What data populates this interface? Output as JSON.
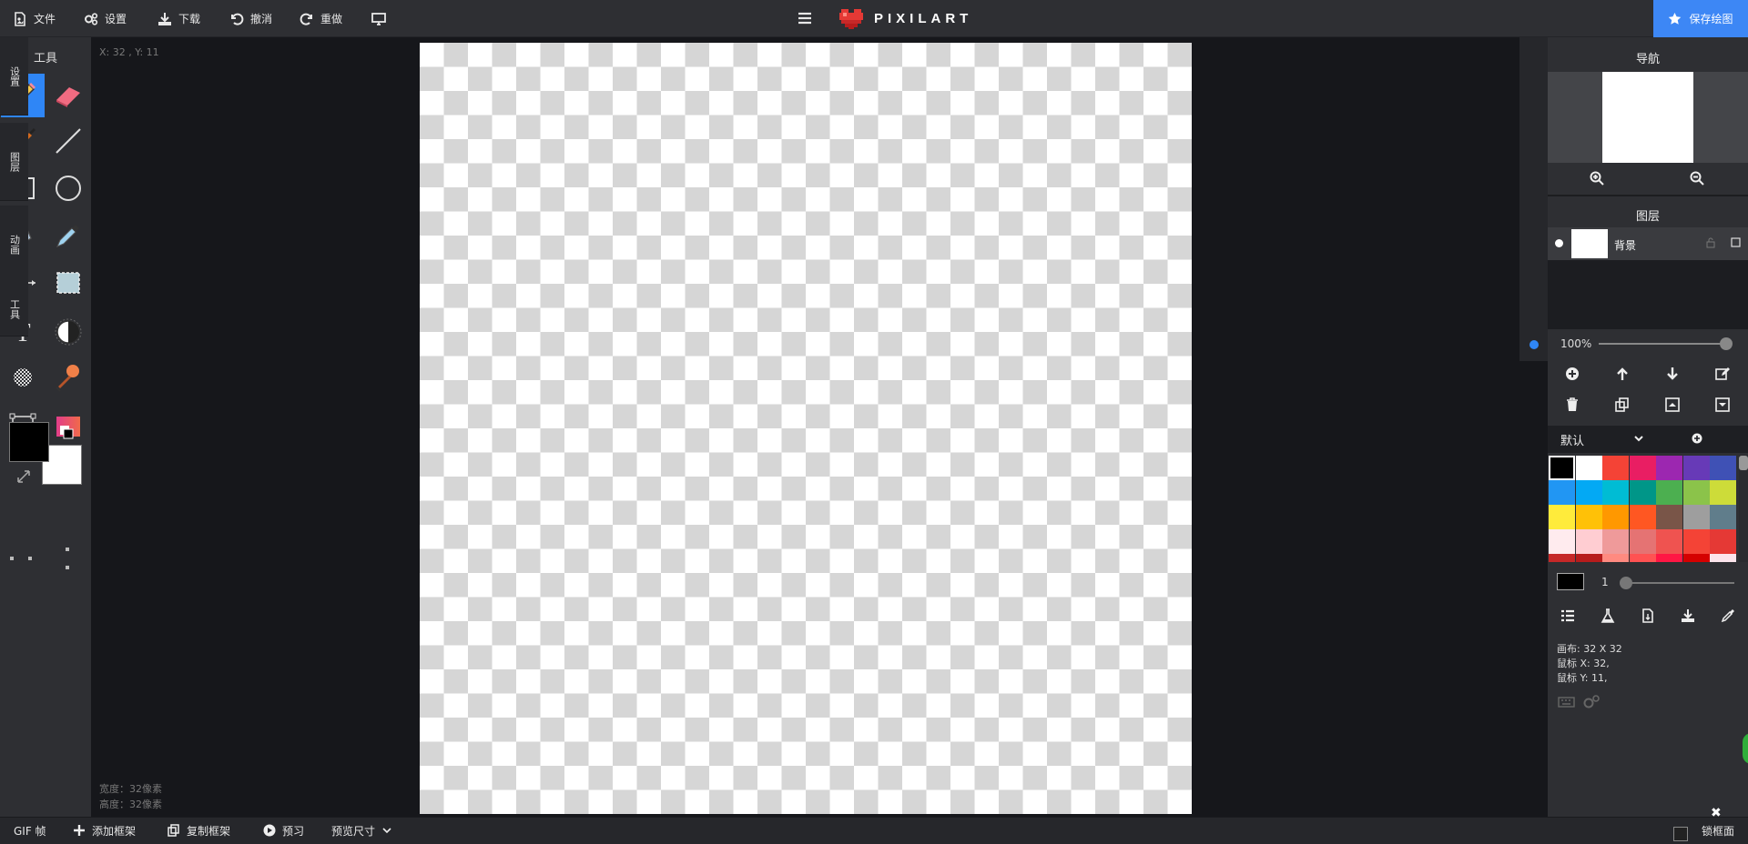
{
  "topbar": {
    "file": "文件",
    "settings": "设置",
    "download": "下载",
    "undo": "撤消",
    "redo": "重做",
    "logo_text": "PIXILART",
    "save_drawing": "保存绘图"
  },
  "tools": {
    "title": "工具",
    "primary_color": "#000000",
    "secondary_color": "#ffffff",
    "active_tool": "pencil"
  },
  "workspace": {
    "cursor_coords": "X: 32 , Y: 11",
    "width_label": "宽度：32像素",
    "height_label": "高度：32像素"
  },
  "vtabs": [
    "设置",
    "图层",
    "动画",
    "工具"
  ],
  "navigation": {
    "title": "导航"
  },
  "layers": {
    "title": "图层",
    "items": [
      {
        "name": "背景"
      }
    ],
    "opacity": "100%"
  },
  "palette": {
    "name": "默认",
    "colors": [
      "#000000",
      "#ffffff",
      "#f44336",
      "#e91e63",
      "#9c27b0",
      "#673ab7",
      "#3f51b5",
      "#2196f3",
      "#03a9f4",
      "#00bcd4",
      "#009688",
      "#4caf50",
      "#8bc34a",
      "#cddc39",
      "#ffeb3b",
      "#ffc107",
      "#ff9800",
      "#ff5722",
      "#795548",
      "#9e9e9e",
      "#607d8b",
      "#ffebee",
      "#ffcdd2",
      "#ef9a9a",
      "#e57373",
      "#ef5350",
      "#f44336",
      "#e53935",
      "#c62828",
      "#b71c1c",
      "#ff8a80",
      "#ff5252",
      "#ff1744",
      "#d50000",
      "#fce4ec"
    ],
    "selected_index": 0
  },
  "brush": {
    "size": "1"
  },
  "info": {
    "canvas": "画布: 32 X 32",
    "mouse_x": "鼠标 X: 32,",
    "mouse_y": "鼠标 Y: 11,"
  },
  "bottombar": {
    "gif_frames": "GIF 帧",
    "add_frame": "添加框架",
    "copy_frame": "复制框架",
    "preview": "预习",
    "preview_size": "预览尺寸",
    "lock_frames": "锁框面"
  }
}
